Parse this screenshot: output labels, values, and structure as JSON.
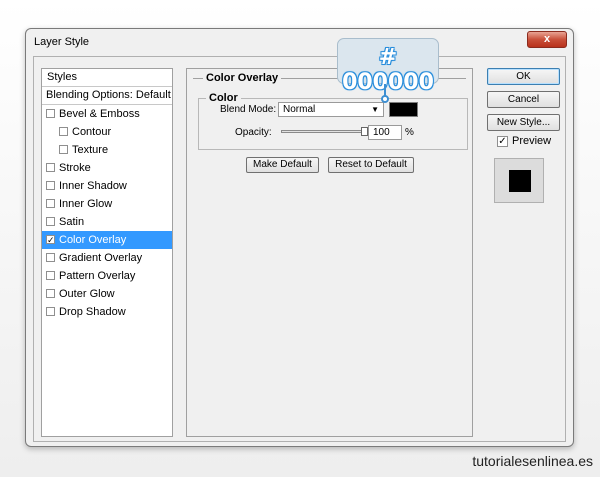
{
  "window": {
    "title": "Layer Style",
    "close_label": "x"
  },
  "styles_panel": {
    "header": "Styles",
    "blending_options": "Blending Options: Default",
    "items": [
      {
        "label": "Bevel & Emboss",
        "checked": false,
        "indent": false,
        "selected": false
      },
      {
        "label": "Contour",
        "checked": false,
        "indent": true,
        "selected": false
      },
      {
        "label": "Texture",
        "checked": false,
        "indent": true,
        "selected": false
      },
      {
        "label": "Stroke",
        "checked": false,
        "indent": false,
        "selected": false
      },
      {
        "label": "Inner Shadow",
        "checked": false,
        "indent": false,
        "selected": false
      },
      {
        "label": "Inner Glow",
        "checked": false,
        "indent": false,
        "selected": false
      },
      {
        "label": "Satin",
        "checked": false,
        "indent": false,
        "selected": false
      },
      {
        "label": "Color Overlay",
        "checked": true,
        "indent": false,
        "selected": true
      },
      {
        "label": "Gradient Overlay",
        "checked": false,
        "indent": false,
        "selected": false
      },
      {
        "label": "Pattern Overlay",
        "checked": false,
        "indent": false,
        "selected": false
      },
      {
        "label": "Outer Glow",
        "checked": false,
        "indent": false,
        "selected": false
      },
      {
        "label": "Drop Shadow",
        "checked": false,
        "indent": false,
        "selected": false
      }
    ]
  },
  "color_overlay": {
    "group_title": "Color Overlay",
    "color_group_title": "Color",
    "blend_mode_label": "Blend Mode:",
    "blend_mode_value": "Normal",
    "color_hex": "#000000",
    "opacity_label": "Opacity:",
    "opacity_value": "100",
    "opacity_unit": "%",
    "opacity_fraction": 1.0,
    "make_default_label": "Make Default",
    "reset_default_label": "Reset to Default"
  },
  "buttons": {
    "ok": "OK",
    "cancel": "Cancel",
    "new_style": "New Style..."
  },
  "preview": {
    "label": "Preview",
    "checked": true
  },
  "callout": {
    "text": "# 000000"
  },
  "watermark": "tutorialesenlinea.es",
  "colors": {
    "selection": "#3399ff",
    "callout_accent": "#2b8fdc",
    "overlay": "#000000"
  }
}
